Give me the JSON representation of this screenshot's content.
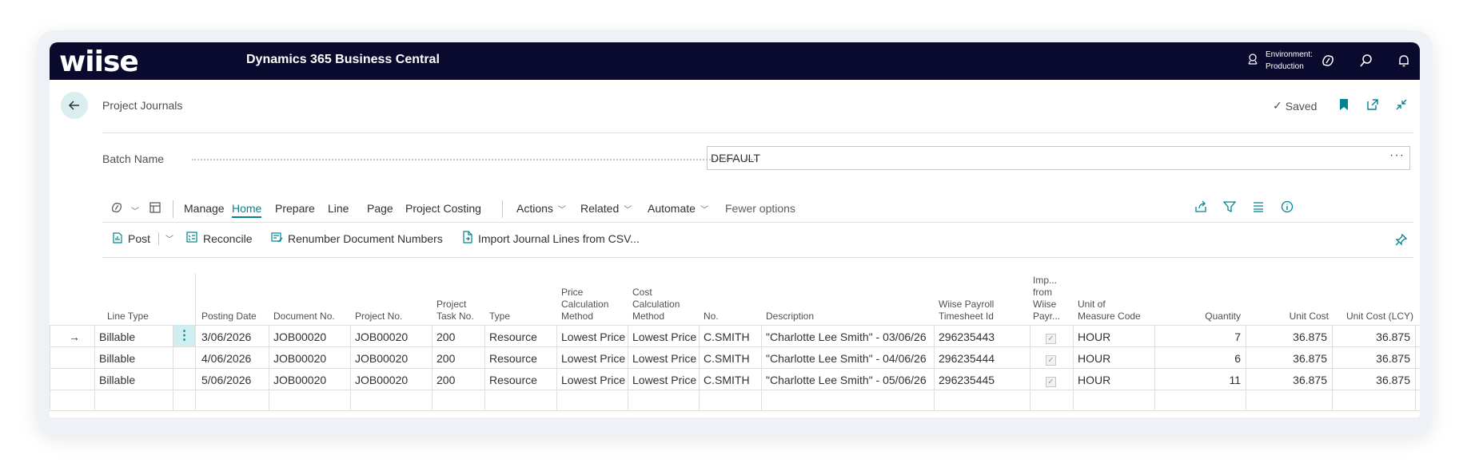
{
  "topbar": {
    "logo": "wiise",
    "app_title": "Dynamics 365 Business Central",
    "environment_label": "Environment:",
    "environment_value": "Production"
  },
  "header": {
    "page_title": "Project Journals",
    "saved_label": "Saved"
  },
  "batch": {
    "label": "Batch Name",
    "value": "DEFAULT",
    "more": "···"
  },
  "actions": {
    "manage": "Manage",
    "home": "Home",
    "prepare": "Prepare",
    "line": "Line",
    "page": "Page",
    "project_costing": "Project Costing",
    "actions": "Actions",
    "related": "Related",
    "automate": "Automate",
    "fewer_options": "Fewer options"
  },
  "commands": {
    "post": "Post",
    "reconcile": "Reconcile",
    "renumber": "Renumber Document Numbers",
    "import": "Import Journal Lines from CSV..."
  },
  "table": {
    "headers": {
      "line_type": "Line Type",
      "posting_date": "Posting Date",
      "document_no": "Document No.",
      "project_no": "Project No.",
      "task_no_1": "Project",
      "task_no_2": "Task No.",
      "type": "Type",
      "price_calc_1": "Price",
      "price_calc_2": "Calculation",
      "price_calc_3": "Method",
      "cost_calc_1": "Cost",
      "cost_calc_2": "Calculation",
      "cost_calc_3": "Method",
      "no": "No.",
      "description": "Description",
      "payroll_1": "Wiise Payroll",
      "payroll_2": "Timesheet Id",
      "imp_1": "Imp...",
      "imp_2": "from",
      "imp_3": "Wiise",
      "imp_4": "Payr...",
      "uom_1": "Unit of",
      "uom_2": "Measure Code",
      "quantity": "Quantity",
      "unit_cost": "Unit Cost",
      "unit_cost_lcy": "Unit Cost (LCY)"
    },
    "rows": [
      {
        "line_type": "Billable",
        "posting_date": "3/06/2026",
        "document_no": "JOB00020",
        "project_no": "JOB00020",
        "task_no": "200",
        "type": "Resource",
        "price_method": "Lowest Price",
        "cost_method": "Lowest Price",
        "no": "C.SMITH",
        "description": "\"Charlotte Lee Smith\" - 03/06/26",
        "timesheet_id": "296235443",
        "imported": true,
        "uom": "HOUR",
        "quantity": "7",
        "unit_cost": "36.875",
        "unit_cost_lcy": "36.875"
      },
      {
        "line_type": "Billable",
        "posting_date": "4/06/2026",
        "document_no": "JOB00020",
        "project_no": "JOB00020",
        "task_no": "200",
        "type": "Resource",
        "price_method": "Lowest Price",
        "cost_method": "Lowest Price",
        "no": "C.SMITH",
        "description": "\"Charlotte Lee Smith\" - 04/06/26",
        "timesheet_id": "296235444",
        "imported": true,
        "uom": "HOUR",
        "quantity": "6",
        "unit_cost": "36.875",
        "unit_cost_lcy": "36.875"
      },
      {
        "line_type": "Billable",
        "posting_date": "5/06/2026",
        "document_no": "JOB00020",
        "project_no": "JOB00020",
        "task_no": "200",
        "type": "Resource",
        "price_method": "Lowest Price",
        "cost_method": "Lowest Price",
        "no": "C.SMITH",
        "description": "\"Charlotte Lee Smith\" - 05/06/26",
        "timesheet_id": "296235445",
        "imported": true,
        "uom": "HOUR",
        "quantity": "11",
        "unit_cost": "36.875",
        "unit_cost_lcy": "36.875"
      }
    ],
    "row_menu_glyph": "⋮",
    "current_row_glyph": "→",
    "check_glyph": "✓"
  },
  "colors": {
    "topbar": "#0a0a2e",
    "accent": "#00848f",
    "frame": "#eef1f6"
  }
}
